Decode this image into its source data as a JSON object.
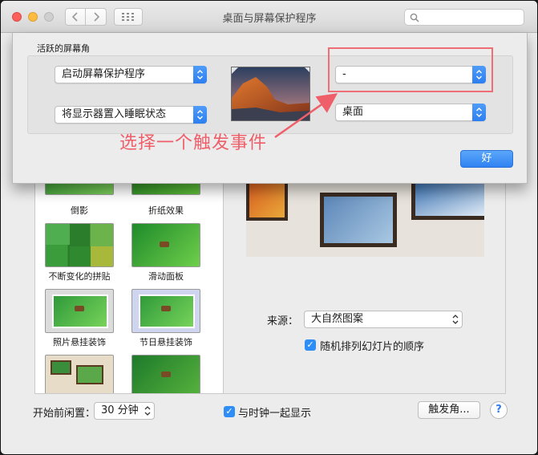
{
  "window": {
    "title": "桌面与屏幕保护程序",
    "search_placeholder": ""
  },
  "hot_corners_sheet": {
    "section_title": "活跃的屏幕角",
    "top_left": "启动屏幕保护程序",
    "bottom_left": "将显示器置入睡眠状态",
    "top_right": "-",
    "bottom_right": "桌面",
    "annotation": "选择一个触发事件",
    "ok_button": "好"
  },
  "screensaver_list": {
    "items": [
      {
        "label": "倒影"
      },
      {
        "label": "折纸效果"
      },
      {
        "label": "不断变化的拼贴"
      },
      {
        "label": "滑动面板"
      },
      {
        "label": "照片悬挂装饰"
      },
      {
        "label": "节日悬挂装饰"
      }
    ]
  },
  "options": {
    "source_label": "来源：",
    "source_value": "大自然图案",
    "shuffle_label": "随机排列幻灯片的顺序",
    "shuffle_checked": true
  },
  "bottom": {
    "idle_label": "开始前闲置：",
    "idle_value": "30 分钟",
    "clock_label": "与时钟一起显示",
    "clock_checked": true,
    "hot_corners_button": "触发角...",
    "help": "?"
  },
  "colors": {
    "accent": "#2f82f2",
    "annotation": "#ee5f6a"
  }
}
